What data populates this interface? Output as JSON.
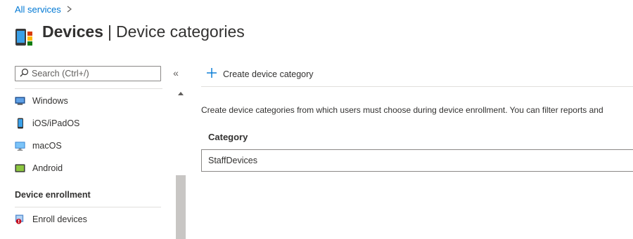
{
  "breadcrumb": {
    "link": "All services",
    "separator": ">"
  },
  "header": {
    "title_bold": "Devices",
    "separator": "|",
    "title_rest": "Device categories",
    "icon": "devices-icon"
  },
  "sidebar": {
    "search_placeholder": "Search (Ctrl+/)",
    "collapse_glyph": "«",
    "items": [
      {
        "label": "Windows",
        "icon": "windows-device-icon"
      },
      {
        "label": "iOS/iPadOS",
        "icon": "ios-device-icon"
      },
      {
        "label": "macOS",
        "icon": "macos-device-icon"
      },
      {
        "label": "Android",
        "icon": "android-device-icon"
      }
    ],
    "section_title": "Device enrollment",
    "enroll_item": {
      "label": "Enroll devices",
      "icon": "enroll-devices-icon"
    }
  },
  "toolbar": {
    "create_label": "Create device category"
  },
  "main": {
    "description": "Create device categories from which users must choose during device enrollment. You can filter reports and",
    "table": {
      "columns": [
        "Category"
      ],
      "rows": [
        [
          "StaffDevices"
        ]
      ]
    }
  },
  "colors": {
    "accent": "#0078d4",
    "scroll_thumb": "#c8c6c4",
    "border": "#8a8886"
  }
}
